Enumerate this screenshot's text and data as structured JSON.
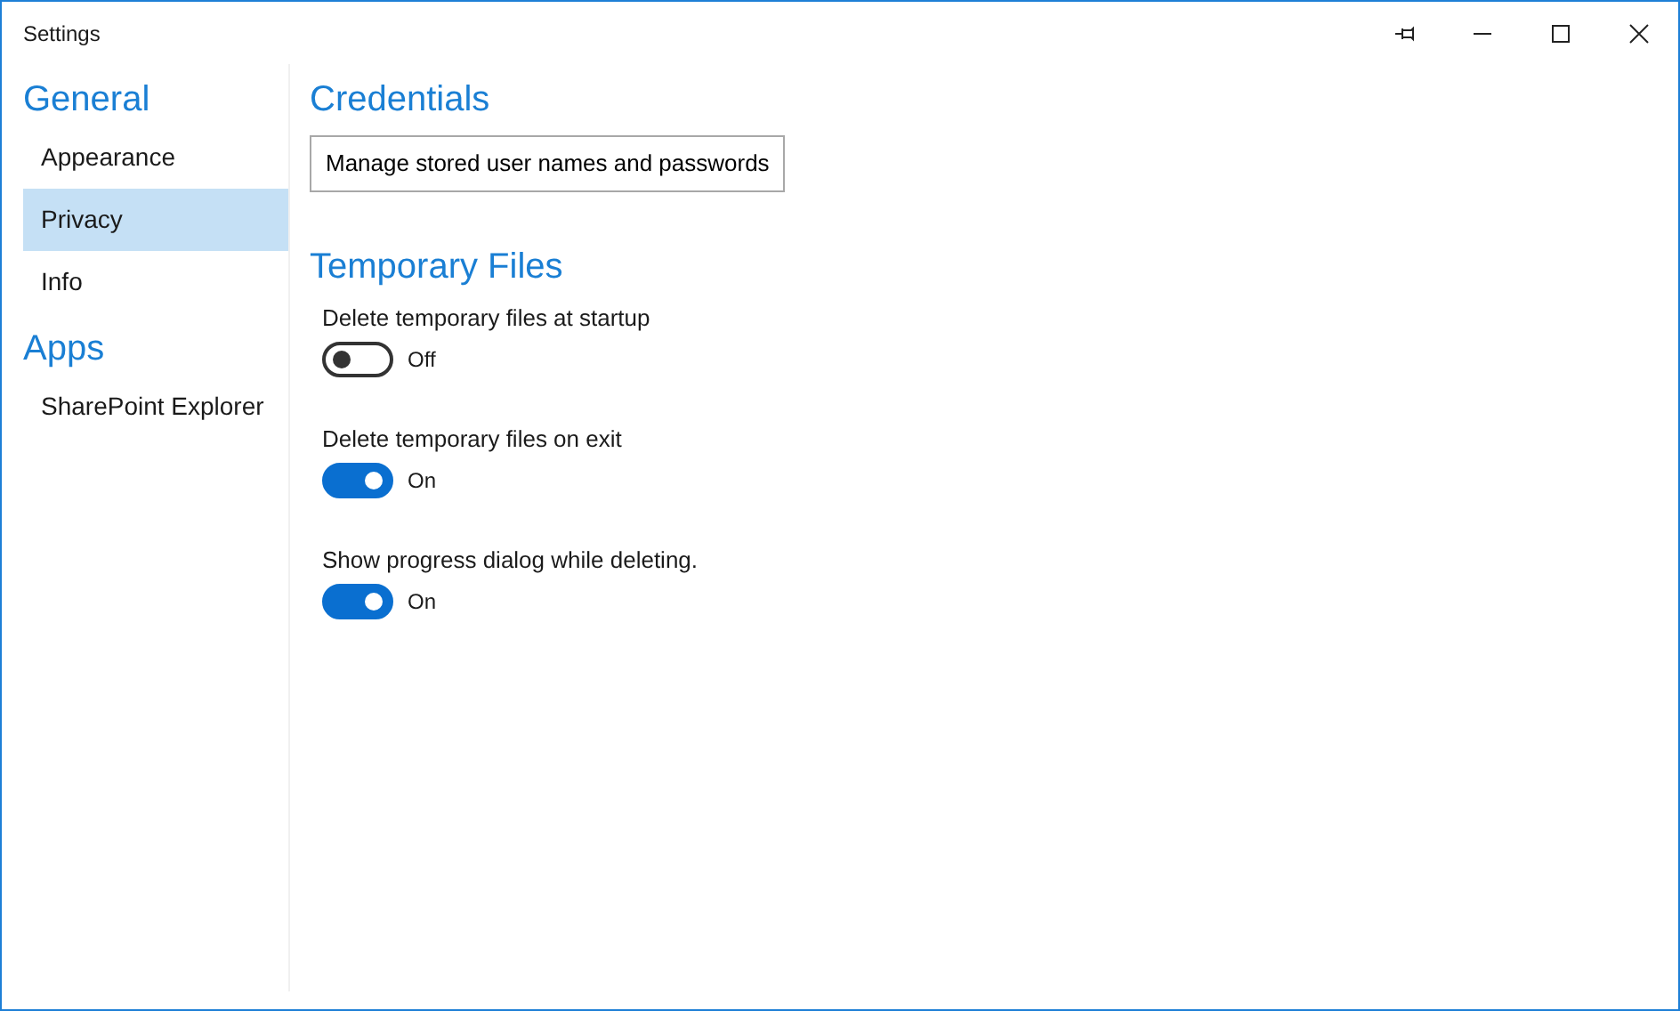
{
  "window": {
    "title": "Settings"
  },
  "sidebar": {
    "groups": [
      {
        "heading": "General",
        "items": [
          {
            "label": "Appearance",
            "selected": false
          },
          {
            "label": "Privacy",
            "selected": true
          },
          {
            "label": "Info",
            "selected": false
          }
        ]
      },
      {
        "heading": "Apps",
        "items": [
          {
            "label": "SharePoint Explorer",
            "selected": false
          }
        ]
      }
    ]
  },
  "sections": [
    {
      "title": "Credentials",
      "kind": "buttons",
      "buttons": [
        "Manage stored user names and passwords"
      ]
    },
    {
      "title": "Temporary Files",
      "kind": "toggles",
      "toggles": [
        {
          "label": "Delete temporary files at startup",
          "on": false,
          "state_text": "Off"
        },
        {
          "label": "Delete temporary files on exit",
          "on": true,
          "state_text": "On"
        },
        {
          "label": "Show progress dialog while deleting.",
          "on": true,
          "state_text": "On"
        }
      ]
    }
  ]
}
